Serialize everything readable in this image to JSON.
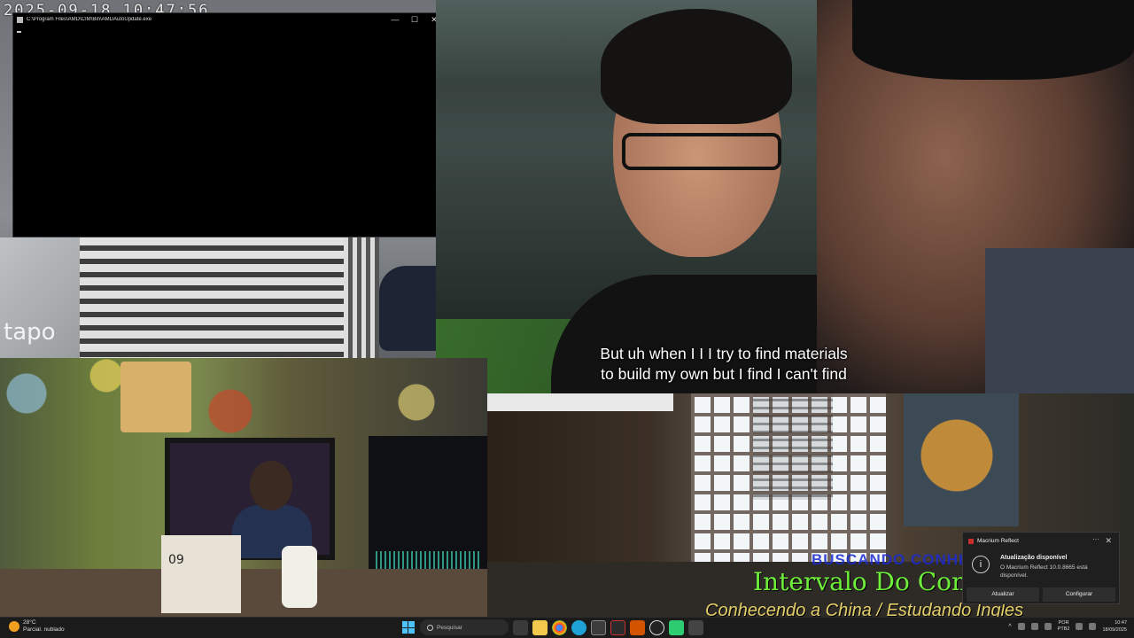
{
  "camera_tl": {
    "timestamp": "2025-09-18 10:47:56",
    "watermark": "tapo"
  },
  "console": {
    "title": "C:\\Program Files\\AMD\\CIM\\Bin\\AMDAutoUpdate.exe",
    "minimize": "—",
    "maximize": "☐",
    "close": "✕"
  },
  "video": {
    "subtitle_line1": "But uh when I I I try to find materials",
    "subtitle_line2": "to build my own but I find I can't find"
  },
  "room_cam": {
    "calendar_day": "09"
  },
  "overlay": {
    "blue_text": "BUSCANDO CONHE",
    "green_text": "Intervalo Do Con",
    "bottom_text": "Conhecendo a China / Estudando Ingles"
  },
  "toast": {
    "app": "Macrium Reflect",
    "more": "···",
    "close": "✕",
    "info_icon": "i",
    "title": "Atualização disponível",
    "message": "O Macrium Reflect 10.0.8665 está disponível.",
    "button_update": "Atualizar",
    "button_configure": "Configurar"
  },
  "taskbar": {
    "weather_temp": "28°C",
    "weather_desc": "Parcial. nublado",
    "search_placeholder": "Pesquisar",
    "lang_line1": "POR",
    "lang_line2": "PTB2",
    "time": "10:47",
    "date": "18/09/2025",
    "icons": [
      "start-icon",
      "search-icon",
      "task-view-icon",
      "file-explorer-icon",
      "chrome-icon",
      "edge-icon",
      "store-icon",
      "terminal-icon",
      "app-icon",
      "obs-icon",
      "app2-icon",
      "app3-icon"
    ]
  },
  "colors": {
    "subtitle": "#ffffff",
    "overlay_blue": "#1a2bd0",
    "overlay_green": "#6ef03a",
    "overlay_gold": "#e4d06a",
    "accent": "#4cc2ff"
  }
}
